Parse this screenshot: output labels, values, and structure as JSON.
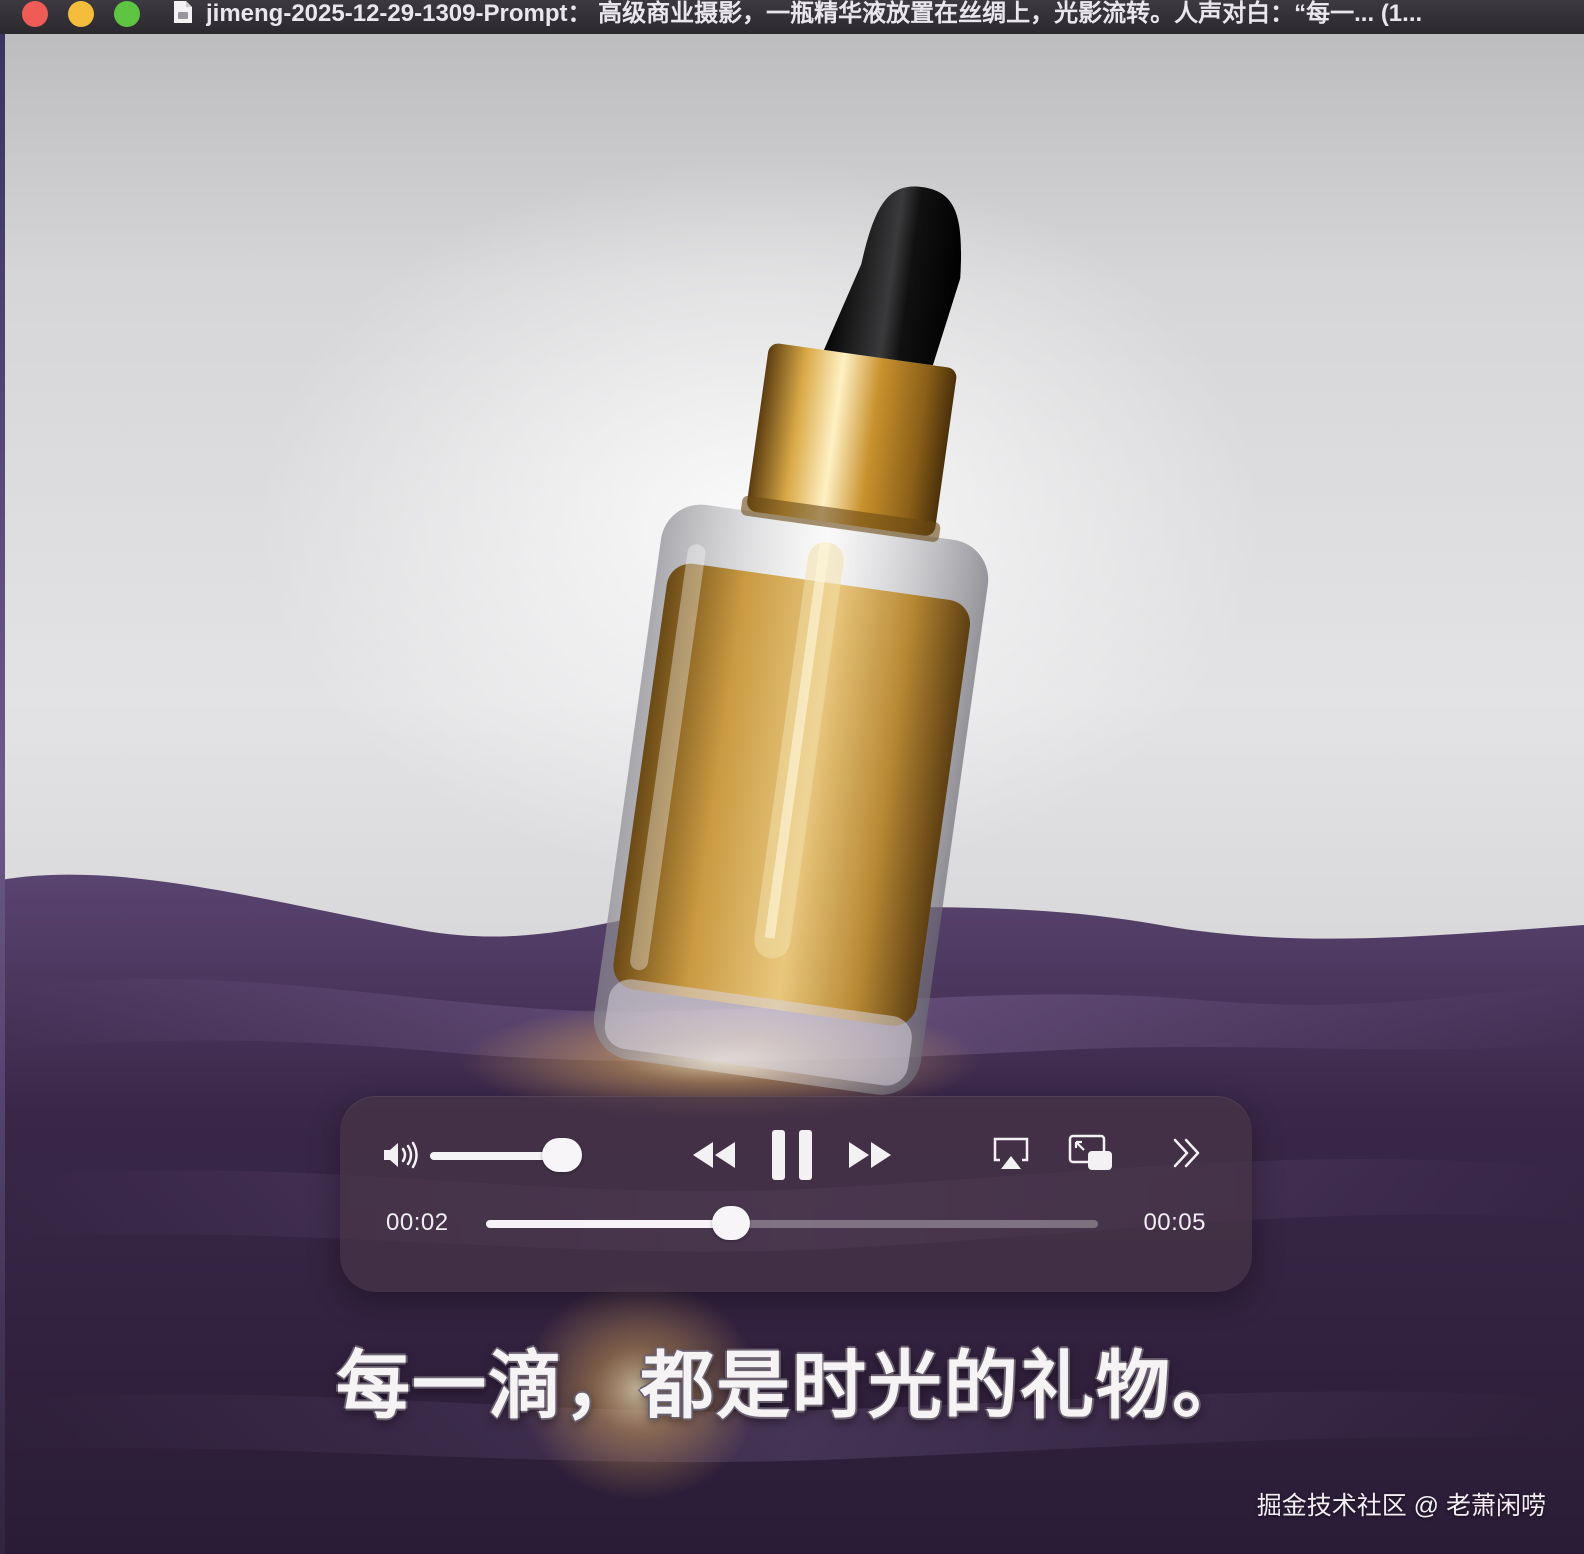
{
  "window": {
    "title": "jimeng-2025-12-29-1309-Prompt： 高级商业摄影，一瓶精华液放置在丝绸上，光影流转。人声对白：“每一... (1..."
  },
  "icons": {
    "document": "document-icon",
    "volume": "speaker-volume-icon",
    "rewind": "rewind-icon",
    "pause": "pause-icon",
    "forward": "fast-forward-icon",
    "airplay": "airplay-icon",
    "pip": "picture-in-picture-icon",
    "more": "double-chevron-right-icon"
  },
  "colors": {
    "close": "#ee5c55",
    "minimize": "#f4bd3c",
    "zoom": "#5dc542",
    "silk": "#3f2a4f",
    "serum": "#c89a3c",
    "cap_gold": "#b8842a"
  },
  "player": {
    "volume_level": 0.88,
    "elapsed": "00:02",
    "total": "00:05",
    "progress": 0.4,
    "state": "playing"
  },
  "video": {
    "subtitle": "每一滴，都是时光的礼物。",
    "watermark": "掘金技术社区 @ 老萧闲唠"
  }
}
